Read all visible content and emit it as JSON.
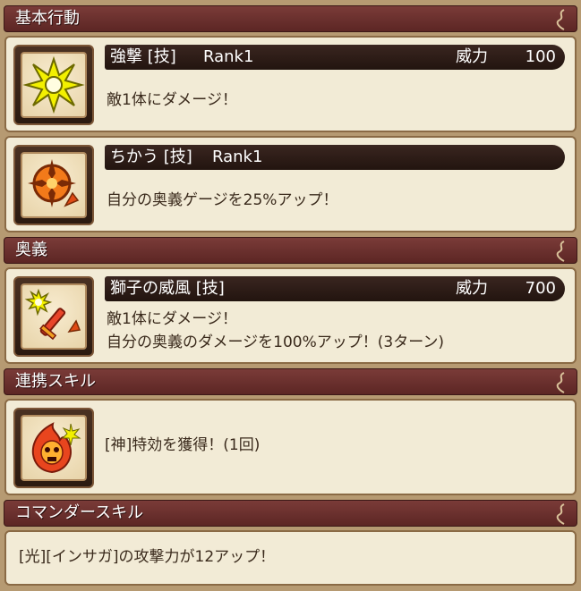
{
  "sections": {
    "basic": {
      "title": "基本行動"
    },
    "ougi": {
      "title": "奥義"
    },
    "link": {
      "title": "連携スキル"
    },
    "commander": {
      "title": "コマンダースキル"
    }
  },
  "basic_skills": [
    {
      "name": "強撃 [技]",
      "rank": "Rank1",
      "power_label": "威力",
      "power": "100",
      "desc": "敵1体にダメージ！"
    },
    {
      "name": "ちかう [技]",
      "rank": "Rank1",
      "desc": "自分の奥義ゲージを25%アップ！"
    }
  ],
  "ougi_skill": {
    "name": "獅子の威風 [技]",
    "power_label": "威力",
    "power": "700",
    "desc_line1": "敵1体にダメージ！",
    "desc_line2": "自分の奥義のダメージを100%アップ！(3ターン)"
  },
  "link_skill": {
    "desc": "[神]特効を獲得！(1回)"
  },
  "commander_skill": {
    "desc": "[光][インサガ]の攻撃力が12アップ！"
  },
  "icons": {
    "strike": "starburst-icon",
    "vow": "crosshair-arrow-icon",
    "ougi": "sword-burst-icon",
    "link": "flame-skull-icon"
  },
  "colors": {
    "header_bg": "#6b302d",
    "card_bg": "#f2ebd6",
    "title_bar": "#2e1c16"
  }
}
